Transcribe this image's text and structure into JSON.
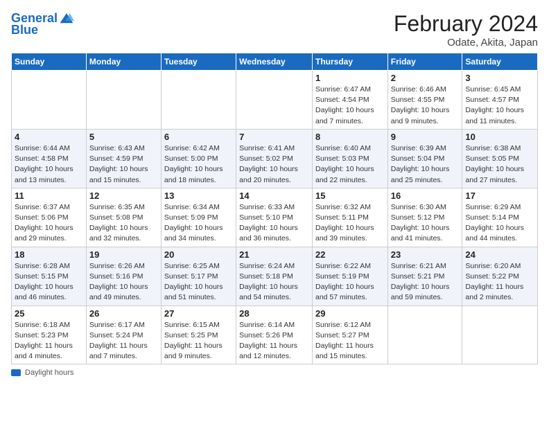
{
  "header": {
    "logo_line1": "General",
    "logo_line2": "Blue",
    "month": "February 2024",
    "location": "Odate, Akita, Japan"
  },
  "days_of_week": [
    "Sunday",
    "Monday",
    "Tuesday",
    "Wednesday",
    "Thursday",
    "Friday",
    "Saturday"
  ],
  "weeks": [
    [
      {
        "day": "",
        "info": ""
      },
      {
        "day": "",
        "info": ""
      },
      {
        "day": "",
        "info": ""
      },
      {
        "day": "",
        "info": ""
      },
      {
        "day": "1",
        "info": "Sunrise: 6:47 AM\nSunset: 4:54 PM\nDaylight: 10 hours\nand 7 minutes."
      },
      {
        "day": "2",
        "info": "Sunrise: 6:46 AM\nSunset: 4:55 PM\nDaylight: 10 hours\nand 9 minutes."
      },
      {
        "day": "3",
        "info": "Sunrise: 6:45 AM\nSunset: 4:57 PM\nDaylight: 10 hours\nand 11 minutes."
      }
    ],
    [
      {
        "day": "4",
        "info": "Sunrise: 6:44 AM\nSunset: 4:58 PM\nDaylight: 10 hours\nand 13 minutes."
      },
      {
        "day": "5",
        "info": "Sunrise: 6:43 AM\nSunset: 4:59 PM\nDaylight: 10 hours\nand 15 minutes."
      },
      {
        "day": "6",
        "info": "Sunrise: 6:42 AM\nSunset: 5:00 PM\nDaylight: 10 hours\nand 18 minutes."
      },
      {
        "day": "7",
        "info": "Sunrise: 6:41 AM\nSunset: 5:02 PM\nDaylight: 10 hours\nand 20 minutes."
      },
      {
        "day": "8",
        "info": "Sunrise: 6:40 AM\nSunset: 5:03 PM\nDaylight: 10 hours\nand 22 minutes."
      },
      {
        "day": "9",
        "info": "Sunrise: 6:39 AM\nSunset: 5:04 PM\nDaylight: 10 hours\nand 25 minutes."
      },
      {
        "day": "10",
        "info": "Sunrise: 6:38 AM\nSunset: 5:05 PM\nDaylight: 10 hours\nand 27 minutes."
      }
    ],
    [
      {
        "day": "11",
        "info": "Sunrise: 6:37 AM\nSunset: 5:06 PM\nDaylight: 10 hours\nand 29 minutes."
      },
      {
        "day": "12",
        "info": "Sunrise: 6:35 AM\nSunset: 5:08 PM\nDaylight: 10 hours\nand 32 minutes."
      },
      {
        "day": "13",
        "info": "Sunrise: 6:34 AM\nSunset: 5:09 PM\nDaylight: 10 hours\nand 34 minutes."
      },
      {
        "day": "14",
        "info": "Sunrise: 6:33 AM\nSunset: 5:10 PM\nDaylight: 10 hours\nand 36 minutes."
      },
      {
        "day": "15",
        "info": "Sunrise: 6:32 AM\nSunset: 5:11 PM\nDaylight: 10 hours\nand 39 minutes."
      },
      {
        "day": "16",
        "info": "Sunrise: 6:30 AM\nSunset: 5:12 PM\nDaylight: 10 hours\nand 41 minutes."
      },
      {
        "day": "17",
        "info": "Sunrise: 6:29 AM\nSunset: 5:14 PM\nDaylight: 10 hours\nand 44 minutes."
      }
    ],
    [
      {
        "day": "18",
        "info": "Sunrise: 6:28 AM\nSunset: 5:15 PM\nDaylight: 10 hours\nand 46 minutes."
      },
      {
        "day": "19",
        "info": "Sunrise: 6:26 AM\nSunset: 5:16 PM\nDaylight: 10 hours\nand 49 minutes."
      },
      {
        "day": "20",
        "info": "Sunrise: 6:25 AM\nSunset: 5:17 PM\nDaylight: 10 hours\nand 51 minutes."
      },
      {
        "day": "21",
        "info": "Sunrise: 6:24 AM\nSunset: 5:18 PM\nDaylight: 10 hours\nand 54 minutes."
      },
      {
        "day": "22",
        "info": "Sunrise: 6:22 AM\nSunset: 5:19 PM\nDaylight: 10 hours\nand 57 minutes."
      },
      {
        "day": "23",
        "info": "Sunrise: 6:21 AM\nSunset: 5:21 PM\nDaylight: 10 hours\nand 59 minutes."
      },
      {
        "day": "24",
        "info": "Sunrise: 6:20 AM\nSunset: 5:22 PM\nDaylight: 11 hours\nand 2 minutes."
      }
    ],
    [
      {
        "day": "25",
        "info": "Sunrise: 6:18 AM\nSunset: 5:23 PM\nDaylight: 11 hours\nand 4 minutes."
      },
      {
        "day": "26",
        "info": "Sunrise: 6:17 AM\nSunset: 5:24 PM\nDaylight: 11 hours\nand 7 minutes."
      },
      {
        "day": "27",
        "info": "Sunrise: 6:15 AM\nSunset: 5:25 PM\nDaylight: 11 hours\nand 9 minutes."
      },
      {
        "day": "28",
        "info": "Sunrise: 6:14 AM\nSunset: 5:26 PM\nDaylight: 11 hours\nand 12 minutes."
      },
      {
        "day": "29",
        "info": "Sunrise: 6:12 AM\nSunset: 5:27 PM\nDaylight: 11 hours\nand 15 minutes."
      },
      {
        "day": "",
        "info": ""
      },
      {
        "day": "",
        "info": ""
      }
    ]
  ],
  "footer": {
    "daylight_label": "Daylight hours"
  }
}
